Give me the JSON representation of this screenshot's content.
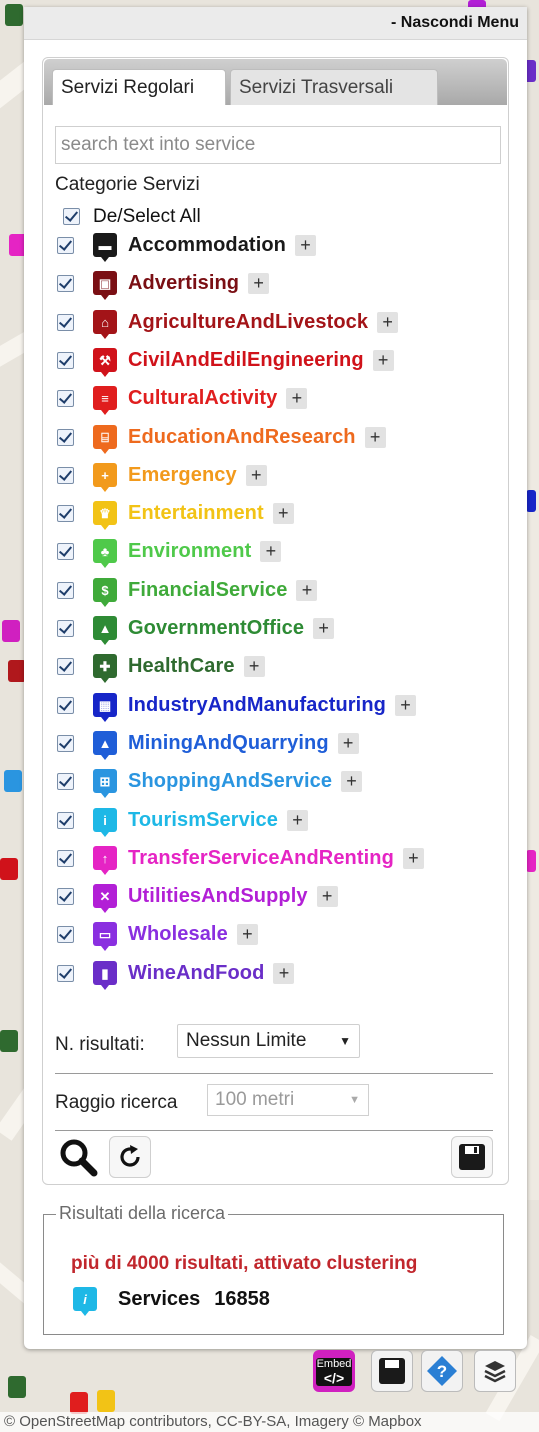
{
  "header": {
    "hide_menu": "- Nascondi Menu"
  },
  "tabs": [
    "Servizi Regolari",
    "Servizi Trasversali"
  ],
  "search": {
    "placeholder": "search text into service",
    "value": ""
  },
  "categories_title": "Categorie Servizi",
  "select_all_label": "De/Select All",
  "plus_label": "+",
  "categories": [
    {
      "label": "Accommodation",
      "color": "#1a1a1a",
      "icon": "bed-icon",
      "glyph": "▬",
      "checked": true
    },
    {
      "label": "Advertising",
      "color": "#7a0f14",
      "icon": "billboard-icon",
      "glyph": "▣",
      "checked": true
    },
    {
      "label": "AgricultureAndLivestock",
      "color": "#a31418",
      "icon": "barn-icon",
      "glyph": "⌂",
      "checked": true
    },
    {
      "label": "CivilAndEdilEngineering",
      "color": "#d0121a",
      "icon": "worker-icon",
      "glyph": "⚒",
      "checked": true
    },
    {
      "label": "CulturalActivity",
      "color": "#e01e1e",
      "icon": "layers-icon",
      "glyph": "≡",
      "checked": true
    },
    {
      "label": "EducationAndResearch",
      "color": "#ee6a1e",
      "icon": "board-icon",
      "glyph": "⌸",
      "checked": true
    },
    {
      "label": "Emergency",
      "color": "#f29a1c",
      "icon": "cross-icon",
      "glyph": "+",
      "checked": true
    },
    {
      "label": "Entertainment",
      "color": "#f2c316",
      "icon": "crown-icon",
      "glyph": "♛",
      "checked": true
    },
    {
      "label": "Environment",
      "color": "#4fc94a",
      "icon": "tree-icon",
      "glyph": "♣",
      "checked": true
    },
    {
      "label": "FinancialService",
      "color": "#3faa3a",
      "icon": "money-bag-icon",
      "glyph": "$",
      "checked": true
    },
    {
      "label": "GovernmentOffice",
      "color": "#2e8b35",
      "icon": "building-icon",
      "glyph": "▲",
      "checked": true
    },
    {
      "label": "HealthCare",
      "color": "#2f6a2f",
      "icon": "hospital-icon",
      "glyph": "✚",
      "checked": true
    },
    {
      "label": "IndustryAndManufacturing",
      "color": "#1726c8",
      "icon": "factory-icon",
      "glyph": "▦",
      "checked": true
    },
    {
      "label": "MiningAndQuarrying",
      "color": "#1f5ed8",
      "icon": "mine-icon",
      "glyph": "▲",
      "checked": true
    },
    {
      "label": "ShoppingAndService",
      "color": "#2a95e0",
      "icon": "cart-icon",
      "glyph": "⊞",
      "checked": true
    },
    {
      "label": "TourismService",
      "color": "#1eb8e6",
      "icon": "info-icon",
      "glyph": "i",
      "checked": true
    },
    {
      "label": "TransferServiceAndRenting",
      "color": "#e524c4",
      "icon": "pin-icon",
      "glyph": "↑",
      "checked": true
    },
    {
      "label": "UtilitiesAndSupply",
      "color": "#b21fd6",
      "icon": "tools-icon",
      "glyph": "✕",
      "checked": true
    },
    {
      "label": "Wholesale",
      "color": "#8a2fe0",
      "icon": "truck-icon",
      "glyph": "▭",
      "checked": true
    },
    {
      "label": "WineAndFood",
      "color": "#6a2ec8",
      "icon": "bottle-icon",
      "glyph": "▮",
      "checked": true
    }
  ],
  "results_limit": {
    "label": "N. risultati:",
    "value": "Nessun Limite"
  },
  "search_radius": {
    "label": "Raggio ricerca",
    "value": "100 metri"
  },
  "results_box": {
    "legend": "Risultati della ricerca",
    "message": "più di 4000 risultati, attivato clustering",
    "services_label": "Services",
    "services_count": "16858"
  },
  "map_controls": {
    "embed_label": "Embed",
    "embed_code": "</>"
  },
  "attribution": "© OpenStreetMap contributors, CC-BY-SA, Imagery © Mapbox"
}
